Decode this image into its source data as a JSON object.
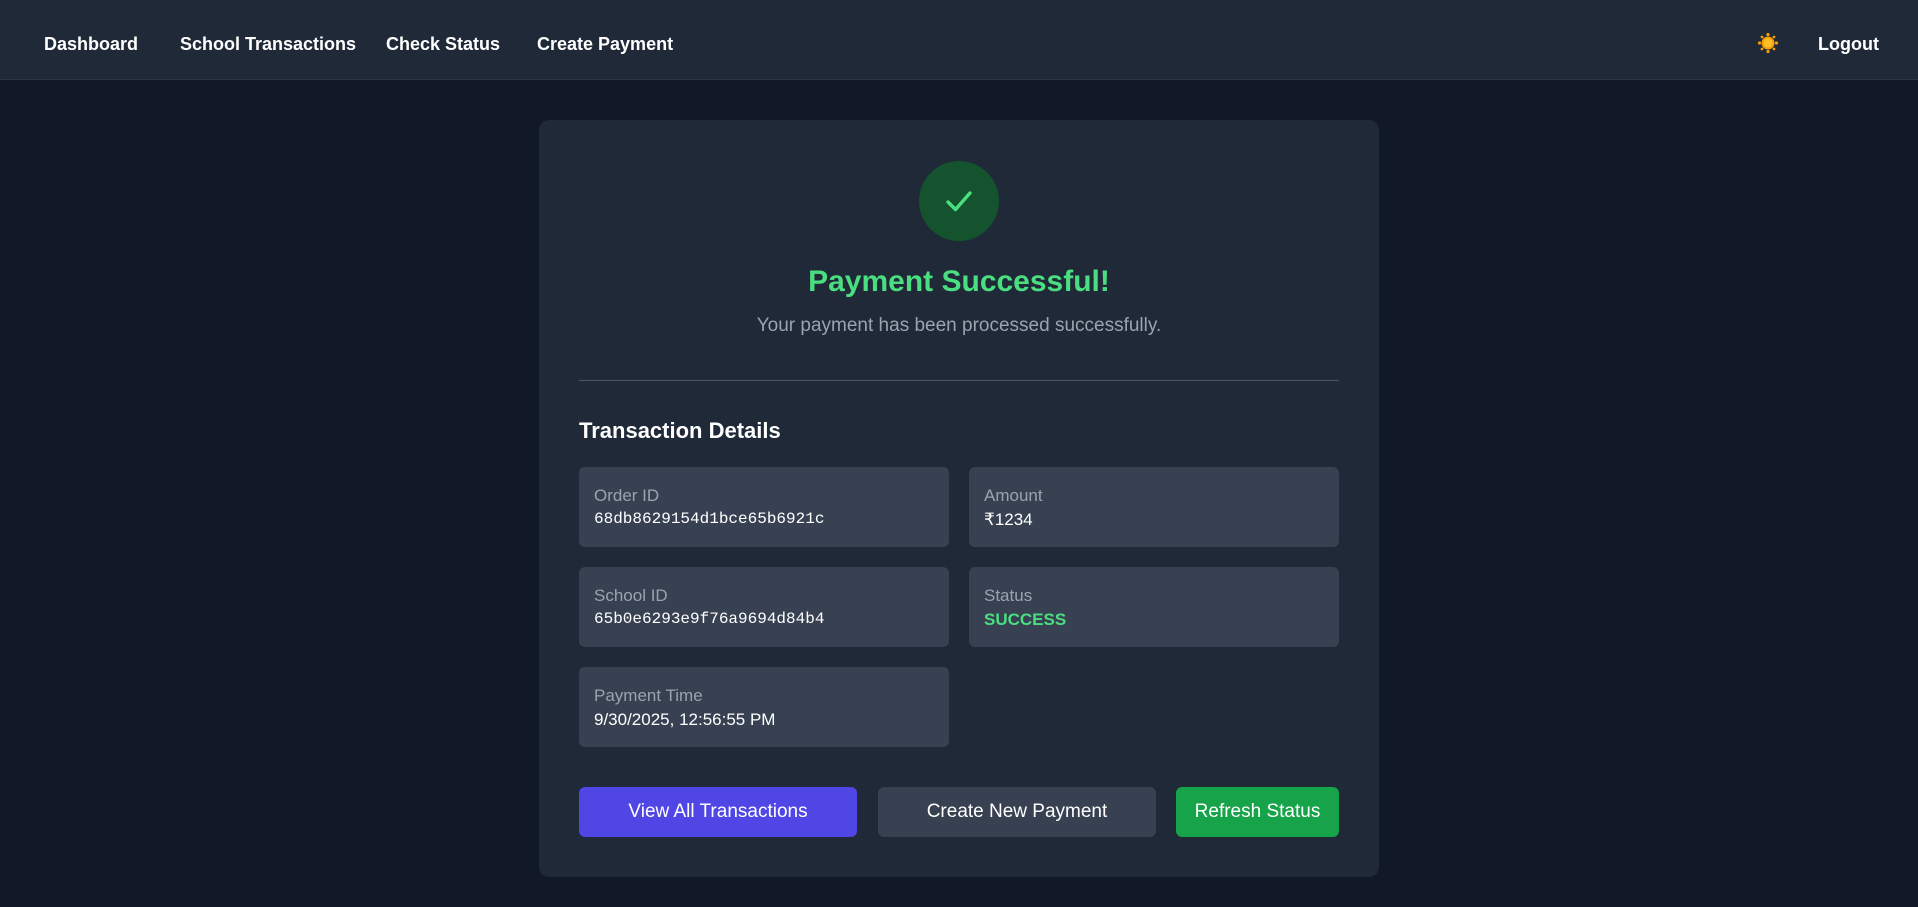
{
  "nav": {
    "links": [
      "Dashboard",
      "School Transactions",
      "Check Status",
      "Create Payment"
    ],
    "logout": "Logout",
    "theme_icon": "sun-icon"
  },
  "result": {
    "icon": "check-icon",
    "title": "Payment Successful!",
    "subtitle": "Your payment has been processed successfully."
  },
  "details": {
    "heading": "Transaction Details",
    "order_id": {
      "label": "Order ID",
      "value": "68db8629154d1bce65b6921c"
    },
    "amount": {
      "label": "Amount",
      "value": "₹1234"
    },
    "school_id": {
      "label": "School ID",
      "value": "65b0e6293e9f76a9694d84b4"
    },
    "status": {
      "label": "Status",
      "value": "SUCCESS"
    },
    "payment_time": {
      "label": "Payment Time",
      "value": "9/30/2025, 12:56:55 PM"
    }
  },
  "actions": {
    "view_all": "View All Transactions",
    "create_new": "Create New Payment",
    "refresh": "Refresh Status"
  },
  "colors": {
    "background": "#111827",
    "surface": "#1f2937",
    "field": "#374151",
    "success": "#4ade80",
    "primary_button": "#4f46e5",
    "success_button": "#16a34a"
  }
}
